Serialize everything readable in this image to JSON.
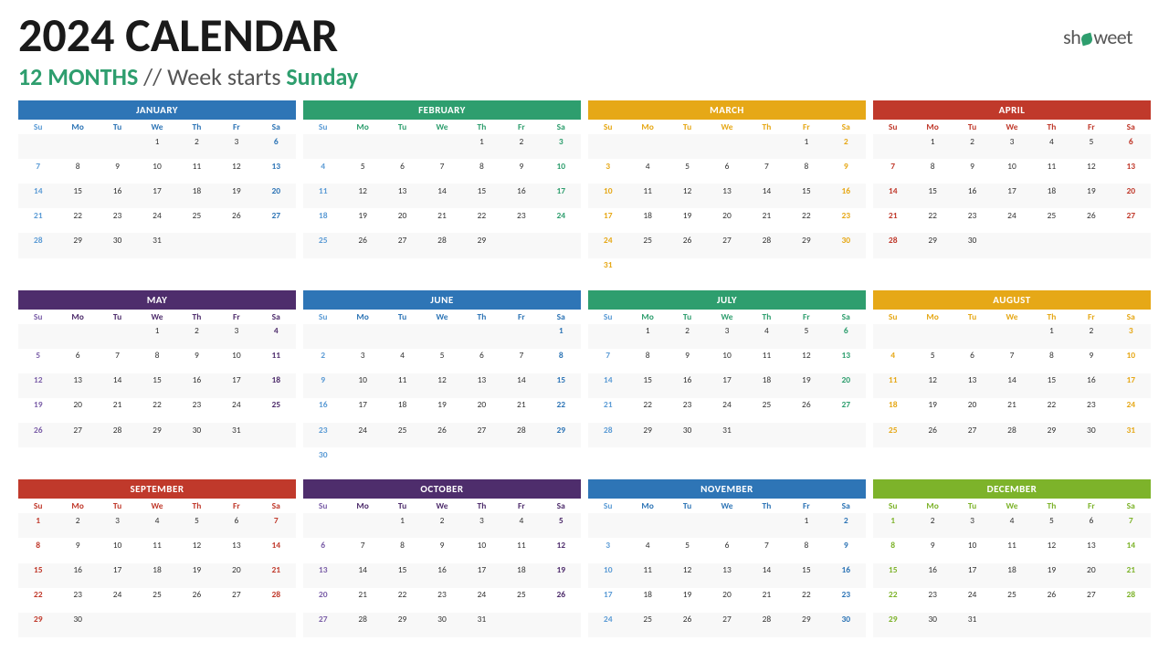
{
  "title": "2024 CALENDAR",
  "subtitle_bold": "12 MONTHS",
  "subtitle_rest": " // Week starts ",
  "subtitle_sunday": "Sunday",
  "logo": "showeet",
  "months": [
    {
      "name": "JANUARY",
      "hdr_class": "hdr-jan",
      "dh_class": "dh-jan",
      "sat_color": "#2e75b6",
      "weeks": [
        [
          "",
          "",
          "",
          "1",
          "2",
          "3",
          "6"
        ],
        [
          "7",
          "8",
          "9",
          "10",
          "11",
          "12",
          "13"
        ],
        [
          "14",
          "15",
          "16",
          "17",
          "18",
          "19",
          "20"
        ],
        [
          "21",
          "22",
          "23",
          "24",
          "25",
          "26",
          "27"
        ],
        [
          "28",
          "29",
          "30",
          "31",
          "",
          "",
          ""
        ],
        [
          "",
          "",
          "",
          "",
          "",
          "",
          ""
        ]
      ],
      "sat_indices": [
        6
      ],
      "sun_indices": [
        0
      ]
    },
    {
      "name": "FEBRUARY",
      "hdr_class": "hdr-feb",
      "dh_class": "dh-feb",
      "sat_color": "#2e9e6e",
      "weeks": [
        [
          "",
          "",
          "",
          "",
          "1",
          "2",
          "3"
        ],
        [
          "4",
          "5",
          "6",
          "7",
          "8",
          "9",
          "10"
        ],
        [
          "11",
          "12",
          "13",
          "14",
          "15",
          "16",
          "17"
        ],
        [
          "18",
          "19",
          "20",
          "21",
          "22",
          "23",
          "24"
        ],
        [
          "25",
          "26",
          "27",
          "28",
          "29",
          "",
          ""
        ],
        [
          "",
          "",
          "",
          "",
          "",
          "",
          ""
        ]
      ]
    },
    {
      "name": "MARCH",
      "hdr_class": "hdr-mar",
      "dh_class": "dh-mar",
      "sat_color": "#e6a817",
      "weeks": [
        [
          "",
          "",
          "",
          "",
          "",
          "1",
          "2"
        ],
        [
          "3",
          "4",
          "5",
          "6",
          "7",
          "8",
          "9"
        ],
        [
          "10",
          "11",
          "12",
          "13",
          "14",
          "15",
          "16"
        ],
        [
          "17",
          "18",
          "19",
          "20",
          "21",
          "22",
          "23"
        ],
        [
          "24",
          "25",
          "26",
          "27",
          "28",
          "29",
          "30"
        ],
        [
          "31",
          "",
          "",
          "",
          "",
          "",
          ""
        ]
      ]
    },
    {
      "name": "APRIL",
      "hdr_class": "hdr-apr",
      "dh_class": "dh-apr",
      "sat_color": "#c0392b",
      "weeks": [
        [
          "",
          "1",
          "2",
          "3",
          "4",
          "5",
          "6"
        ],
        [
          "7",
          "8",
          "9",
          "10",
          "11",
          "12",
          "13"
        ],
        [
          "14",
          "15",
          "16",
          "17",
          "18",
          "19",
          "20"
        ],
        [
          "21",
          "22",
          "23",
          "24",
          "25",
          "26",
          "27"
        ],
        [
          "28",
          "29",
          "30",
          "",
          "",
          "",
          ""
        ],
        [
          "",
          "",
          "",
          "",
          "",
          "",
          ""
        ]
      ]
    },
    {
      "name": "MAY",
      "hdr_class": "hdr-may",
      "dh_class": "dh-may",
      "sat_color": "#4e2d6c",
      "weeks": [
        [
          "",
          "",
          "",
          "1",
          "2",
          "3",
          "4"
        ],
        [
          "5",
          "6",
          "7",
          "8",
          "9",
          "10",
          "11"
        ],
        [
          "12",
          "13",
          "14",
          "15",
          "16",
          "17",
          "18"
        ],
        [
          "19",
          "20",
          "21",
          "22",
          "23",
          "24",
          "25"
        ],
        [
          "26",
          "27",
          "28",
          "29",
          "30",
          "31",
          ""
        ],
        [
          "",
          "",
          "",
          "",
          "",
          "",
          ""
        ]
      ]
    },
    {
      "name": "JUNE",
      "hdr_class": "hdr-jun",
      "dh_class": "dh-jun",
      "sat_color": "#2e75b6",
      "weeks": [
        [
          "",
          "",
          "",
          "",
          "",
          "",
          "1"
        ],
        [
          "2",
          "3",
          "4",
          "5",
          "6",
          "7",
          "8"
        ],
        [
          "9",
          "10",
          "11",
          "12",
          "13",
          "14",
          "15"
        ],
        [
          "16",
          "17",
          "18",
          "19",
          "20",
          "21",
          "22"
        ],
        [
          "23",
          "24",
          "25",
          "26",
          "27",
          "28",
          "29"
        ],
        [
          "30",
          "",
          "",
          "",
          "",
          "",
          ""
        ]
      ]
    },
    {
      "name": "JULY",
      "hdr_class": "hdr-jul",
      "dh_class": "dh-jul",
      "sat_color": "#2e9e6e",
      "weeks": [
        [
          "",
          "1",
          "2",
          "3",
          "4",
          "5",
          "6"
        ],
        [
          "7",
          "8",
          "9",
          "10",
          "11",
          "12",
          "13"
        ],
        [
          "14",
          "15",
          "16",
          "17",
          "18",
          "19",
          "20"
        ],
        [
          "21",
          "22",
          "23",
          "24",
          "25",
          "26",
          "27"
        ],
        [
          "28",
          "29",
          "30",
          "31",
          "",
          "",
          ""
        ],
        [
          "",
          "",
          "",
          "",
          "",
          "",
          ""
        ]
      ]
    },
    {
      "name": "AUGUST",
      "hdr_class": "hdr-aug",
      "dh_class": "dh-aug",
      "sat_color": "#e6a817",
      "weeks": [
        [
          "",
          "",
          "",
          "",
          "1",
          "2",
          "3"
        ],
        [
          "4",
          "5",
          "6",
          "7",
          "8",
          "9",
          "10"
        ],
        [
          "11",
          "12",
          "13",
          "14",
          "15",
          "16",
          "17"
        ],
        [
          "18",
          "19",
          "20",
          "21",
          "22",
          "23",
          "24"
        ],
        [
          "25",
          "26",
          "27",
          "28",
          "29",
          "30",
          "31"
        ],
        [
          "",
          "",
          "",
          "",
          "",
          "",
          ""
        ]
      ]
    },
    {
      "name": "SEPTEMBER",
      "hdr_class": "hdr-sep",
      "dh_class": "dh-sep",
      "sat_color": "#c0392b",
      "weeks": [
        [
          "1",
          "2",
          "3",
          "4",
          "5",
          "6",
          "7"
        ],
        [
          "8",
          "9",
          "10",
          "11",
          "12",
          "13",
          "14"
        ],
        [
          "15",
          "16",
          "17",
          "18",
          "19",
          "20",
          "21"
        ],
        [
          "22",
          "23",
          "24",
          "25",
          "26",
          "27",
          "28"
        ],
        [
          "29",
          "30",
          "",
          "",
          "",
          "",
          ""
        ],
        [
          "",
          "",
          "",
          "",
          "",
          "",
          ""
        ]
      ]
    },
    {
      "name": "OCTOBER",
      "hdr_class": "hdr-oct",
      "dh_class": "dh-oct",
      "sat_color": "#4e2d6c",
      "weeks": [
        [
          "",
          "",
          "1",
          "2",
          "3",
          "4",
          "5"
        ],
        [
          "6",
          "7",
          "8",
          "9",
          "10",
          "11",
          "12"
        ],
        [
          "13",
          "14",
          "15",
          "16",
          "17",
          "18",
          "19"
        ],
        [
          "20",
          "21",
          "22",
          "23",
          "24",
          "25",
          "26"
        ],
        [
          "27",
          "28",
          "29",
          "30",
          "31",
          "",
          ""
        ],
        [
          "",
          "",
          "",
          "",
          "",
          "",
          ""
        ]
      ]
    },
    {
      "name": "NOVEMBER",
      "hdr_class": "hdr-nov",
      "dh_class": "dh-nov",
      "sat_color": "#2e75b6",
      "weeks": [
        [
          "",
          "",
          "",
          "",
          "",
          "1",
          "2"
        ],
        [
          "3",
          "4",
          "5",
          "6",
          "7",
          "8",
          "9"
        ],
        [
          "10",
          "11",
          "12",
          "13",
          "14",
          "15",
          "16"
        ],
        [
          "17",
          "18",
          "19",
          "20",
          "21",
          "22",
          "23"
        ],
        [
          "24",
          "25",
          "26",
          "27",
          "28",
          "29",
          "30"
        ],
        [
          "",
          "",
          "",
          "",
          "",
          "",
          ""
        ]
      ]
    },
    {
      "name": "DECEMBER",
      "hdr_class": "hdr-dec",
      "dh_class": "dh-dec",
      "sat_color": "#7db32a",
      "weeks": [
        [
          "1",
          "2",
          "3",
          "4",
          "5",
          "6",
          "7"
        ],
        [
          "8",
          "9",
          "10",
          "11",
          "12",
          "13",
          "14"
        ],
        [
          "15",
          "16",
          "17",
          "18",
          "19",
          "20",
          "21"
        ],
        [
          "22",
          "23",
          "24",
          "25",
          "26",
          "27",
          "28"
        ],
        [
          "29",
          "30",
          "31",
          "",
          "",
          "",
          ""
        ],
        [
          "",
          "",
          "",
          "",
          "",
          "",
          ""
        ]
      ]
    }
  ],
  "day_labels": [
    "Su",
    "Mo",
    "Tu",
    "We",
    "Th",
    "Fr",
    "Sa"
  ]
}
